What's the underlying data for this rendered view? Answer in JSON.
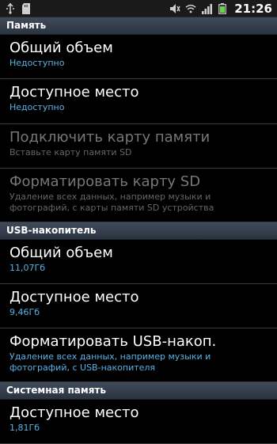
{
  "status_bar": {
    "left_icons": [
      "usb-icon",
      "sd-card-icon"
    ],
    "right_icons": [
      "mute-icon",
      "wifi-icon",
      "signal-icon",
      "battery-icon"
    ],
    "time": "21:26"
  },
  "sections": [
    {
      "header": "Память",
      "items": [
        {
          "title": "Общий объем",
          "subtitle": "Недоступно",
          "enabled": true
        },
        {
          "title": "Доступное место",
          "subtitle": "Недоступно",
          "enabled": true
        },
        {
          "title": "Подключить карту памяти",
          "subtitle": "Вставьте карту памяти SD",
          "enabled": false
        },
        {
          "title": "Форматировать карту SD",
          "subtitle": "Удаление всех данных, например музыки и фотографий, с карты памяти SD устройства",
          "enabled": false
        }
      ]
    },
    {
      "header": "USB-накопитель",
      "items": [
        {
          "title": "Общий объем",
          "subtitle": "11,07Гб",
          "enabled": true
        },
        {
          "title": "Доступное место",
          "subtitle": "9,46Гб",
          "enabled": true
        },
        {
          "title": "Форматировать USB-накоп.",
          "subtitle": "Удаление всех данных, например музыки и фотографий, с USB-накопителя",
          "enabled": true
        }
      ]
    },
    {
      "header": "Системная память",
      "items": [
        {
          "title": "Доступное место",
          "subtitle": "1,81Гб",
          "enabled": true
        }
      ]
    }
  ]
}
